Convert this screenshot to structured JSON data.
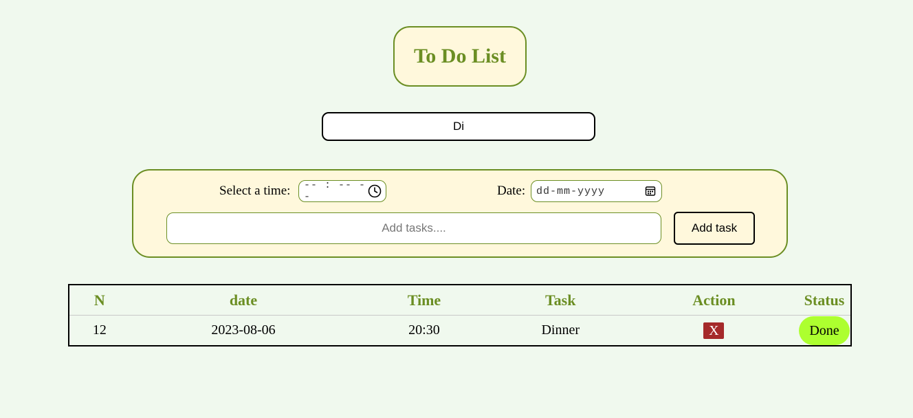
{
  "header": {
    "title": "To Do List"
  },
  "search": {
    "value": "Di",
    "placeholder": ""
  },
  "form": {
    "time_label": "Select a time:",
    "time_placeholder": "-- : --  --",
    "time_icon": "clock-icon",
    "date_label": "Date:",
    "date_placeholder": "dd-mm-yyyy",
    "date_icon": "calendar-icon",
    "task_placeholder": "Add tasks....",
    "add_button_label": "Add task"
  },
  "table": {
    "headers": {
      "n": "N",
      "date": "date",
      "time": "Time",
      "task": "Task",
      "action": "Action",
      "status": "Status"
    },
    "rows": [
      {
        "n": "12",
        "date": "2023-08-06",
        "time": "20:30",
        "task": "Dinner",
        "action_label": "X",
        "status_label": "Done"
      }
    ]
  },
  "colors": {
    "accent": "#6b8e23",
    "panel_background": "#fff8dc",
    "page_background": "#f0f9ee",
    "delete_button": "#a52a2a",
    "done_button": "#adff2f"
  }
}
